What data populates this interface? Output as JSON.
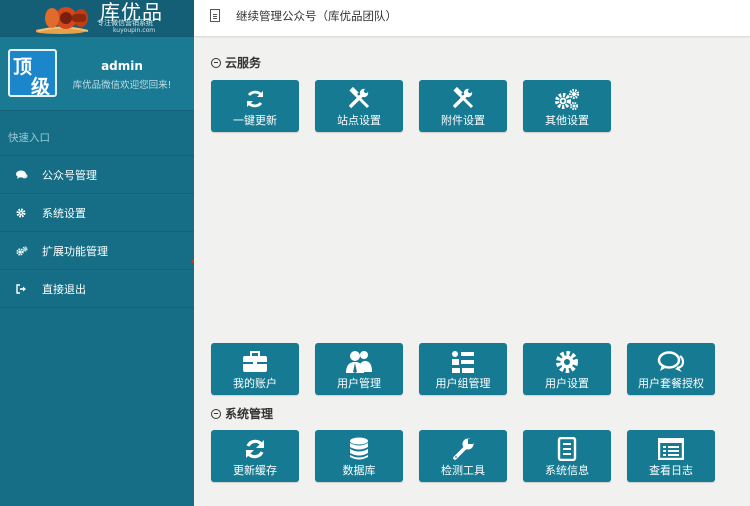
{
  "logo": {
    "name": "库优品",
    "tagline": "专注微信营销系统",
    "url": "kuyoupin.com"
  },
  "profile": {
    "avatar_text_1": "顶",
    "avatar_text_2": "级",
    "username": "admin",
    "welcome": "库优品微信欢迎您回来!"
  },
  "sidebar": {
    "section_label": "快速入口",
    "items": [
      {
        "label": "公众号管理",
        "icon": "comments-icon"
      },
      {
        "label": "系统设置",
        "icon": "gear-icon"
      },
      {
        "label": "扩展功能管理",
        "icon": "gears-icon"
      },
      {
        "label": "直接退出",
        "icon": "sign-out-icon"
      }
    ]
  },
  "header": {
    "title": "继续管理公众号（库优品团队）"
  },
  "sections": {
    "cloud": "云服务",
    "system": "系统管理"
  },
  "tiles": {
    "cloud": [
      {
        "label": "一键更新",
        "icon": "refresh-icon"
      },
      {
        "label": "站点设置",
        "icon": "tools-icon"
      },
      {
        "label": "附件设置",
        "icon": "tools-icon"
      },
      {
        "label": "其他设置",
        "icon": "gears-icon"
      }
    ],
    "accounts": [
      {
        "label": "我的账户",
        "icon": "briefcase-icon"
      },
      {
        "label": "用户管理",
        "icon": "users-icon"
      },
      {
        "label": "用户组管理",
        "icon": "user-group-icon"
      },
      {
        "label": "用户设置",
        "icon": "gear-icon"
      },
      {
        "label": "用户套餐授权",
        "icon": "chat-icon"
      }
    ],
    "system": [
      {
        "label": "更新缓存",
        "icon": "refresh-icon"
      },
      {
        "label": "数据库",
        "icon": "database-icon"
      },
      {
        "label": "检测工具",
        "icon": "wrench-icon"
      },
      {
        "label": "系统信息",
        "icon": "file-text-icon"
      },
      {
        "label": "查看日志",
        "icon": "list-icon"
      }
    ]
  },
  "colors": {
    "sidebar": "#156e86",
    "tile": "#167a92",
    "background": "#f1f1ef"
  }
}
